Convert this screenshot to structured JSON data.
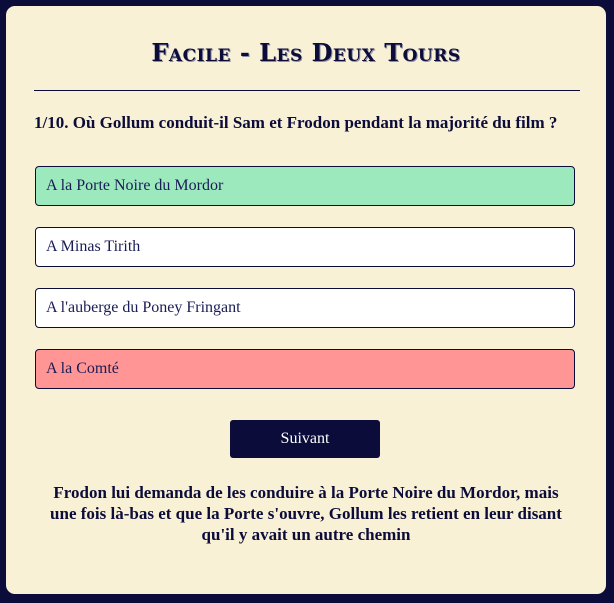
{
  "quiz": {
    "title": "Facile - Les Deux Tours",
    "question": "1/10. Où Gollum conduit-il Sam et Frodon pendant la majorité du film ?",
    "answers": [
      {
        "label": "A la Porte Noire du Mordor",
        "state": "correct"
      },
      {
        "label": "A Minas Tirith",
        "state": "neutral"
      },
      {
        "label": "A l'auberge du Poney Fringant",
        "state": "neutral"
      },
      {
        "label": "A la Comté",
        "state": "wrong"
      }
    ],
    "next_label": "Suivant",
    "explanation": "Frodon lui demanda de les conduire à la Porte Noire du Mordor, mais une fois là-bas et que la Porte s'ouvre, Gollum les retient en leur disant qu'il y avait un autre chemin"
  },
  "colors": {
    "background": "#0b0c3a",
    "card": "#f9f1d6",
    "correct": "#9be9bd",
    "wrong": "#ff9595"
  }
}
